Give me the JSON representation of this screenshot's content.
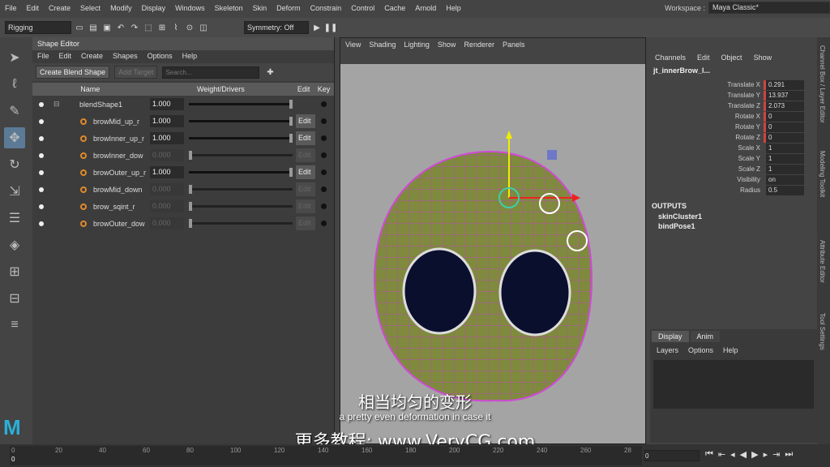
{
  "menubar": {
    "items": [
      "File",
      "Edit",
      "Create",
      "Select",
      "Modify",
      "Display",
      "Windows",
      "Skeleton",
      "Skin",
      "Deform",
      "Constrain",
      "Control",
      "Cache",
      "Arnold",
      "Help"
    ],
    "workspace_label": "Workspace :",
    "workspace_value": "Maya Classic*"
  },
  "shelf": {
    "mode": "Rigging",
    "symmetry": "Symmetry: Off"
  },
  "shape_editor": {
    "title": "Shape Editor",
    "menu": [
      "File",
      "Edit",
      "Create",
      "Shapes",
      "Options",
      "Help"
    ],
    "create_blend": "Create Blend Shape",
    "add_target": "Add Target",
    "search_placeholder": "Search...",
    "columns": {
      "name": "Name",
      "weight": "Weight/Drivers",
      "edit": "Edit",
      "key": "Key"
    },
    "rows": [
      {
        "name": "blendShape1",
        "value": "1.000",
        "weight": 1.0,
        "enabled": true,
        "edit": ""
      },
      {
        "name": "browMid_up_r",
        "value": "1.000",
        "weight": 1.0,
        "enabled": true,
        "edit": "Edit"
      },
      {
        "name": "browInner_up_r",
        "value": "1.000",
        "weight": 1.0,
        "enabled": true,
        "edit": "Edit"
      },
      {
        "name": "browInner_dow",
        "value": "0.000",
        "weight": 0.0,
        "enabled": false,
        "edit": "Edit"
      },
      {
        "name": "browOuter_up_r",
        "value": "1.000",
        "weight": 1.0,
        "enabled": true,
        "edit": "Edit"
      },
      {
        "name": "browMid_down",
        "value": "0.000",
        "weight": 0.0,
        "enabled": false,
        "edit": "Edit"
      },
      {
        "name": "brow_sqint_r",
        "value": "0.000",
        "weight": 0.0,
        "enabled": false,
        "edit": "Edit"
      },
      {
        "name": "browOuter_dow",
        "value": "0.000",
        "weight": 0.0,
        "enabled": false,
        "edit": "Edit"
      }
    ]
  },
  "viewport": {
    "menu": [
      "View",
      "Shading",
      "Lighting",
      "Show",
      "Renderer",
      "Panels"
    ]
  },
  "channel_box": {
    "menu": [
      "Channels",
      "Edit",
      "Object",
      "Show"
    ],
    "object": "jt_innerBrow_l...",
    "attrs": [
      {
        "label": "Translate X",
        "value": "0.291",
        "keyed": true
      },
      {
        "label": "Translate Y",
        "value": "13.937",
        "keyed": true
      },
      {
        "label": "Translate Z",
        "value": "2.073",
        "keyed": true
      },
      {
        "label": "Rotate X",
        "value": "0",
        "keyed": true
      },
      {
        "label": "Rotate Y",
        "value": "0",
        "keyed": true
      },
      {
        "label": "Rotate Z",
        "value": "0",
        "keyed": true
      },
      {
        "label": "Scale X",
        "value": "1",
        "keyed": false
      },
      {
        "label": "Scale Y",
        "value": "1",
        "keyed": false
      },
      {
        "label": "Scale Z",
        "value": "1",
        "keyed": false
      },
      {
        "label": "Visibility",
        "value": "on",
        "keyed": false
      },
      {
        "label": "Radius",
        "value": "0.5",
        "keyed": false
      }
    ],
    "outputs_label": "OUTPUTS",
    "outputs": [
      "skinCluster1",
      "bindPose1"
    ],
    "display_tabs": [
      "Display",
      "Anim"
    ],
    "layer_menu": [
      "Layers",
      "Options",
      "Help"
    ]
  },
  "side_tabs": [
    "Channel Box / Layer Editor",
    "Modeling Toolkit",
    "Attribute Editor",
    "Tool Settings"
  ],
  "timeline": {
    "ticks": [
      "0",
      "20",
      "40",
      "60",
      "80",
      "100",
      "120",
      "140",
      "160",
      "180",
      "200",
      "220",
      "240",
      "260",
      "28"
    ],
    "current": "0",
    "frame_field": "0",
    "start_frame": "0"
  },
  "subtitles": {
    "zh": "相当均匀的变形",
    "en": "a pretty even deformation in case it",
    "watermark": "更多教程: www.VeryCG.com"
  }
}
